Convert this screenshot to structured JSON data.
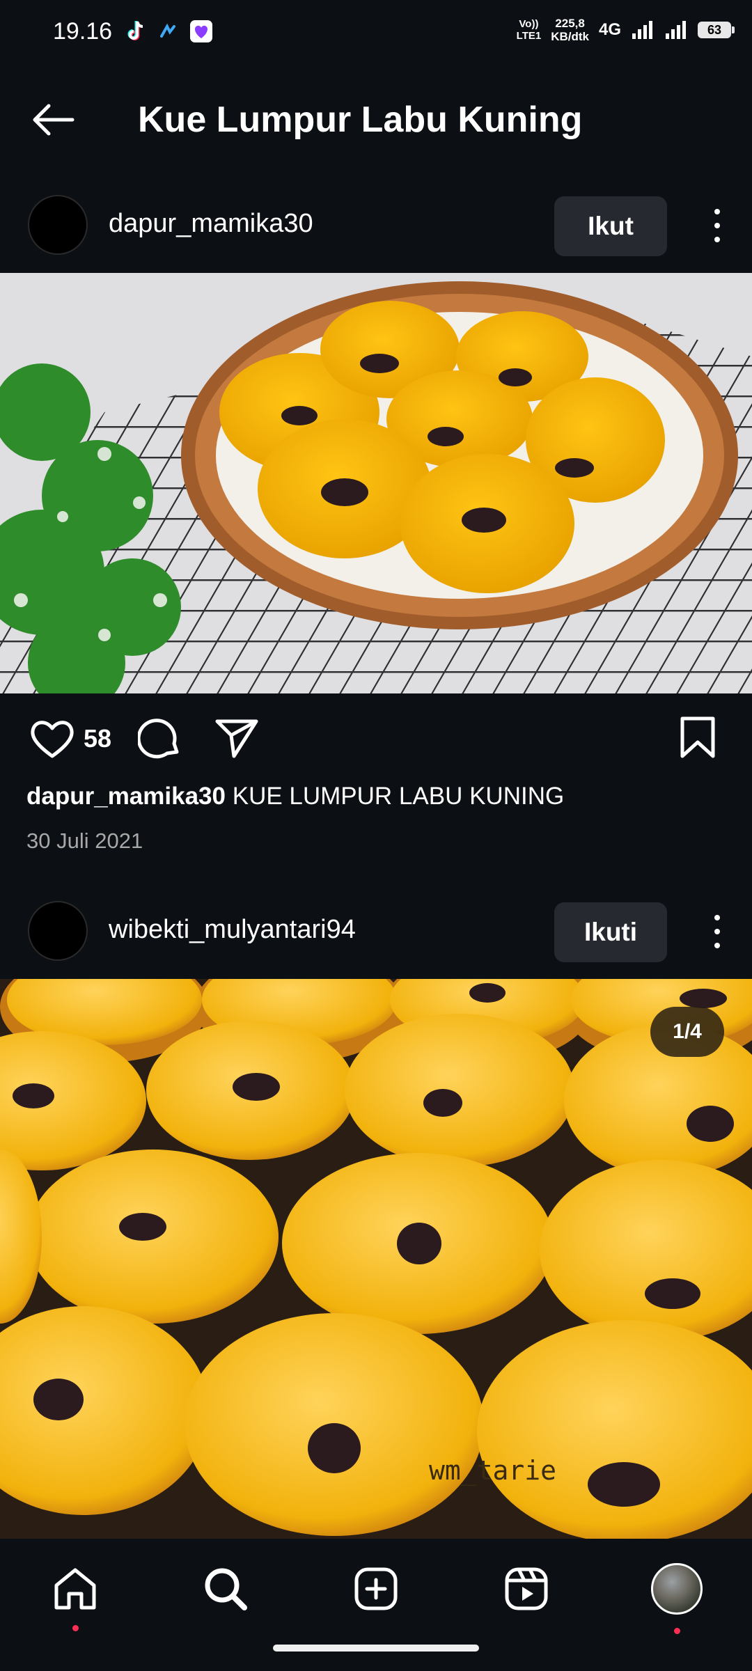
{
  "status_bar": {
    "time": "19.16",
    "volte_top": "Vo))",
    "volte_bottom": "LTE1",
    "speed_value": "225,8",
    "speed_unit": "KB/dtk",
    "network": "4G",
    "battery": "63"
  },
  "header": {
    "title": "Kue Lumpur Labu Kuning"
  },
  "posts": [
    {
      "username": "dapur_mamika30",
      "follow_label": "Ikut",
      "likes": "58",
      "caption_user": "dapur_mamika30",
      "caption_text": "KUE LUMPUR LABU KUNING",
      "date": "30 Juli 2021"
    },
    {
      "username": "wibekti_mulyantari94",
      "follow_label": "Ikuti",
      "page_indicator": "1/4",
      "watermark": "wm_tarie"
    }
  ],
  "colors": {
    "background": "#0c0f14",
    "button_bg": "#262a30",
    "notification_dot": "#ff2e55",
    "cake_yellow": "#f2b20c"
  },
  "icons": {
    "back": "arrow-left-icon",
    "like": "heart-icon",
    "comment": "comment-icon",
    "share": "send-icon",
    "save": "bookmark-icon",
    "nav": [
      "home-icon",
      "search-icon",
      "add-post-icon",
      "reels-icon",
      "profile-avatar"
    ]
  }
}
